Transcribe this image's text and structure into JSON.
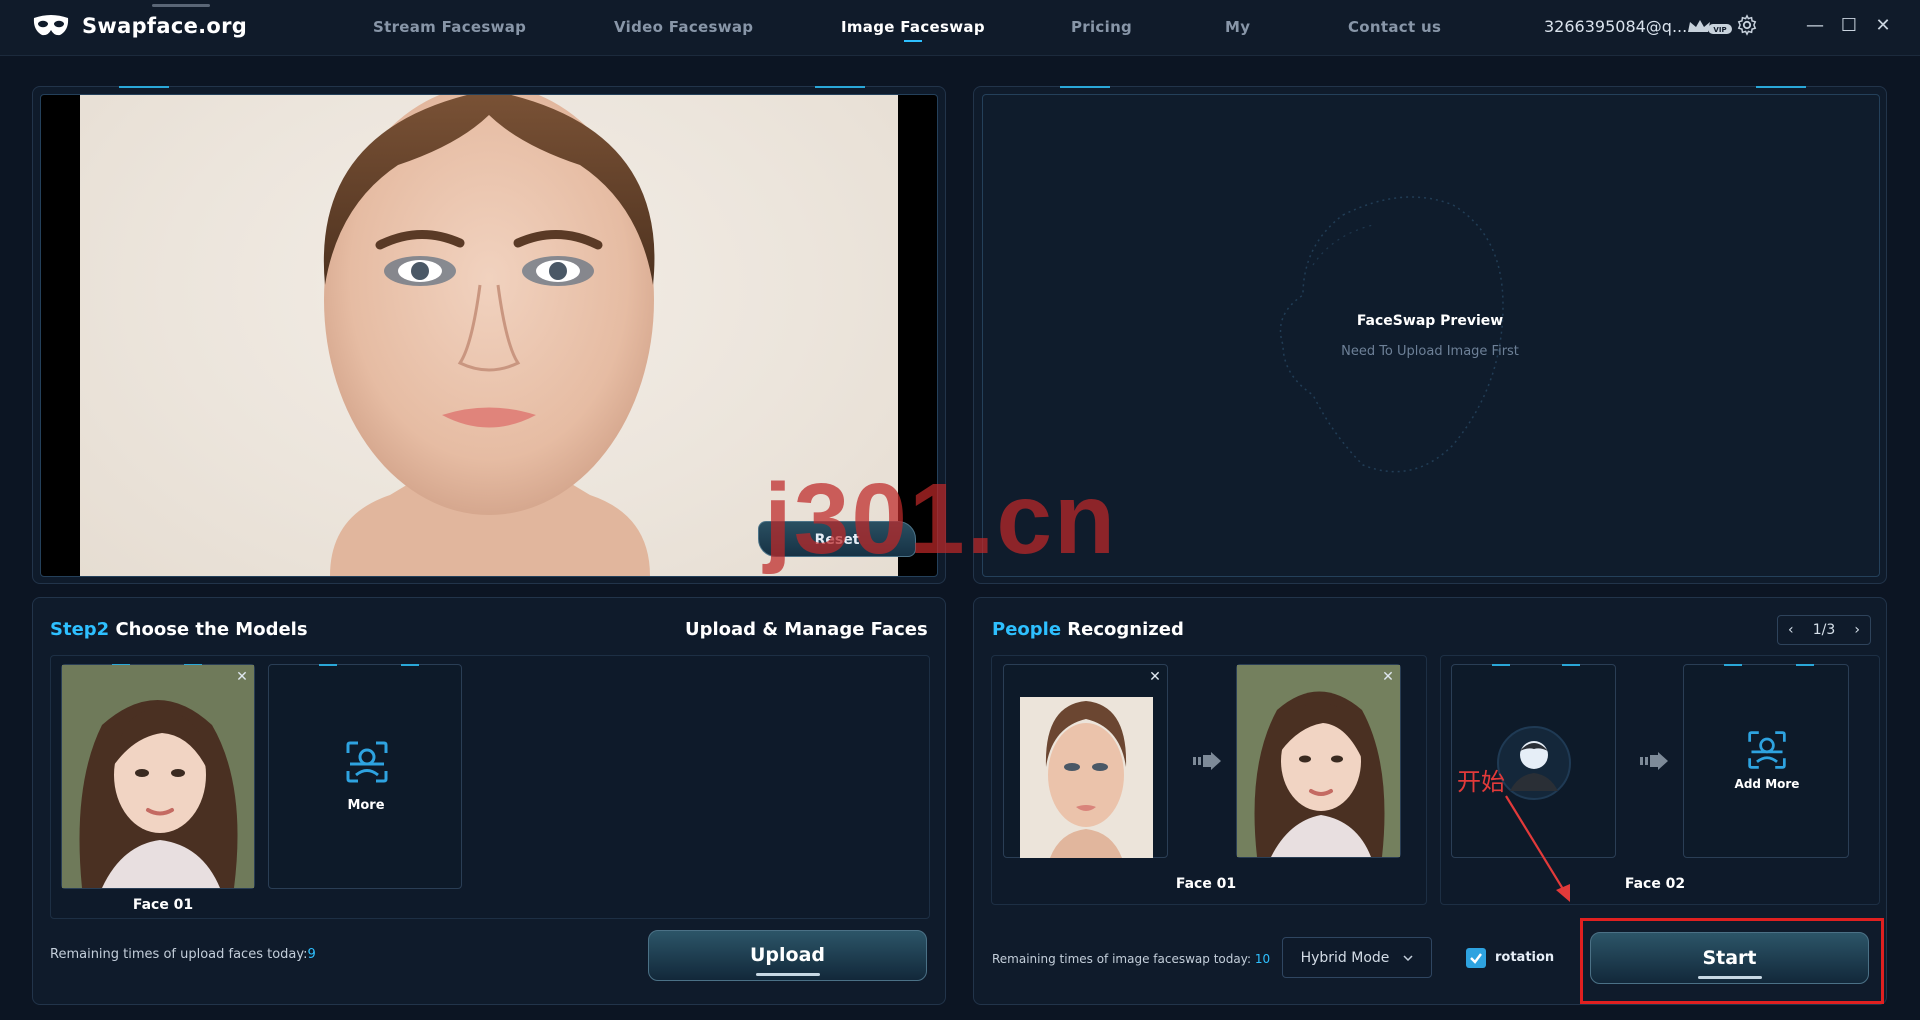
{
  "app": {
    "title": "Swapface.org"
  },
  "nav": [
    {
      "label": "Stream Faceswap"
    },
    {
      "label": "Video Faceswap"
    },
    {
      "label": "Image Faceswap",
      "active": true
    },
    {
      "label": "Pricing"
    },
    {
      "label": "My"
    },
    {
      "label": "Contact us"
    }
  ],
  "account": {
    "email": "3266395084@q...",
    "badge": "VIP"
  },
  "window_controls": {
    "minimize": "—",
    "maximize": "☐",
    "close": "✕"
  },
  "source_panel": {
    "reset_label": "Reset"
  },
  "preview_panel": {
    "title": "FaceSwap Preview",
    "subtitle": "Need To Upload Image First"
  },
  "watermark": "j301.cn",
  "models_panel": {
    "title_highlight": "Step2",
    "title_rest": " Choose the Models",
    "action_title": "Upload & Manage Faces",
    "cards": [
      {
        "label": "Face 01"
      }
    ],
    "more_label": "More",
    "remaining_prefix": "Remaining times of upload faces today:",
    "remaining_count": "9",
    "upload_label": "Upload"
  },
  "people_panel": {
    "title_highlight": "People",
    "title_rest": " Recognized",
    "pager": {
      "prev": "‹",
      "text": "1/3",
      "next": "›"
    },
    "pairs": [
      {
        "label": "Face 01"
      },
      {
        "label": "Face 02"
      }
    ],
    "add_more_label": "Add More",
    "remaining_prefix": "Remaining times of image faceswap today: ",
    "remaining_count": "10",
    "mode_value": "Hybrid Mode",
    "rotation_label": "rotation",
    "rotation_checked": true,
    "start_label": "Start"
  },
  "annotation": {
    "text": "开始"
  },
  "colors": {
    "accent": "#2ec0ff",
    "highlight_red": "#e02020"
  }
}
